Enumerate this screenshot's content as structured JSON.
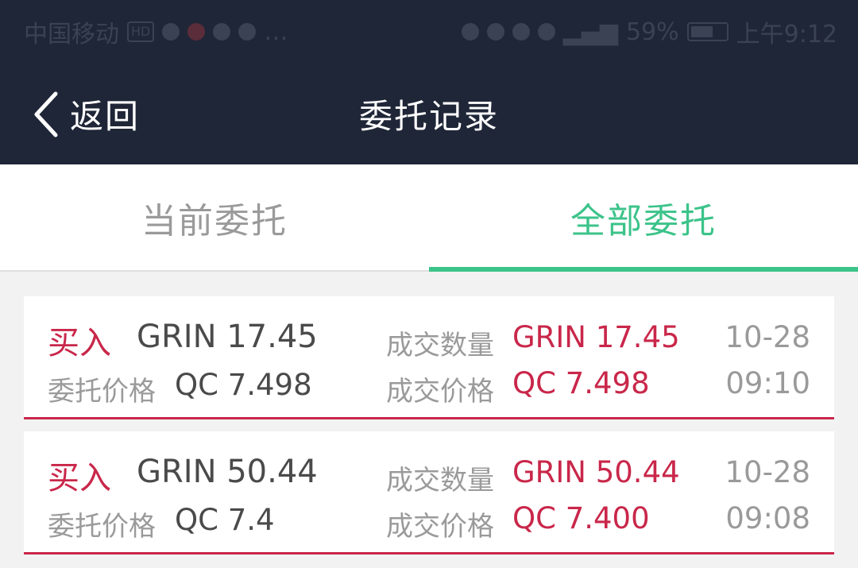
{
  "status_bar": {
    "carrier": "中国移动",
    "hd_badge": "HD",
    "battery": "59%",
    "time": "上午9:12",
    "icons": [
      "hd-badge-icon",
      "app-notification-icon",
      "wechat-icon",
      "message-icon",
      "more-icon",
      "headset-icon",
      "vibrate-icon",
      "alarm-icon",
      "eye-icon",
      "signal-icon",
      "battery-icon"
    ]
  },
  "nav": {
    "back_label": "返回",
    "title": "委托记录"
  },
  "tabs": [
    {
      "label": "当前委托",
      "active": false
    },
    {
      "label": "全部委托",
      "active": true
    }
  ],
  "orders": [
    {
      "side": "买入",
      "amount": "GRIN 17.45",
      "price_label": "委托价格",
      "price": "QC 7.498",
      "filled_qty_label": "成交数量",
      "filled_qty": "GRIN 17.45",
      "filled_price_label": "成交价格",
      "filled_price": "QC 7.498",
      "date": "10-28",
      "time": "09:10"
    },
    {
      "side": "买入",
      "amount": "GRIN 50.44",
      "price_label": "委托价格",
      "price": "QC 7.4",
      "filled_qty_label": "成交数量",
      "filled_qty": "GRIN 50.44",
      "filled_price_label": "成交价格",
      "filled_price": "QC 7.400",
      "date": "10-28",
      "time": "09:08"
    }
  ],
  "colors": {
    "header_bg": "#1f2637",
    "accent_green": "#3cc38a",
    "buy_red": "#c9274a"
  }
}
